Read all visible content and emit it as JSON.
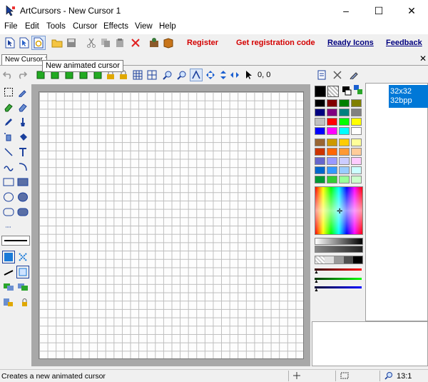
{
  "window": {
    "title": "ArtCursors - New Cursor 1",
    "minimize": "–",
    "maximize": "☐",
    "close": "✕"
  },
  "menu": [
    "File",
    "Edit",
    "Tools",
    "Cursor",
    "Effects",
    "View",
    "Help"
  ],
  "toolbar": {
    "links": [
      {
        "label": "Register",
        "color": "#d40000"
      },
      {
        "label": "Get registration code",
        "color": "#d40000"
      },
      {
        "label": "Ready Icons",
        "color": "#00007f"
      },
      {
        "label": "Feedback",
        "color": "#00007f"
      }
    ]
  },
  "tab": {
    "label": "New Cursor 1",
    "close": "✕"
  },
  "tooltip": "New animated cursor",
  "drawbar": {
    "coordinates": "0, 0"
  },
  "sizes": [
    {
      "line1": "32x32",
      "line2": "32bpp"
    }
  ],
  "status": {
    "message": "Creates a new animated cursor",
    "zoom": "13:1"
  },
  "palette": {
    "primary": "#000000",
    "basic_colors": [
      "#000000",
      "#800000",
      "#008000",
      "#808000",
      "#000080",
      "#800080",
      "#008080",
      "#808080",
      "#c0c0c0",
      "#ff0000",
      "#00ff00",
      "#ffff00",
      "#0000ff",
      "#ff00ff",
      "#00ffff",
      "#ffffff"
    ],
    "custom_colors": [
      "#996633",
      "#cc9900",
      "#ffcc00",
      "#ffff99",
      "#cc3300",
      "#ff6600",
      "#ff9933",
      "#ffcc99",
      "#6666cc",
      "#9999ff",
      "#ccccff",
      "#ffccff",
      "#0066cc",
      "#3399ff",
      "#99ccff",
      "#ccffff",
      "#009933",
      "#33cc33",
      "#99ff99",
      "#ccffcc"
    ]
  }
}
